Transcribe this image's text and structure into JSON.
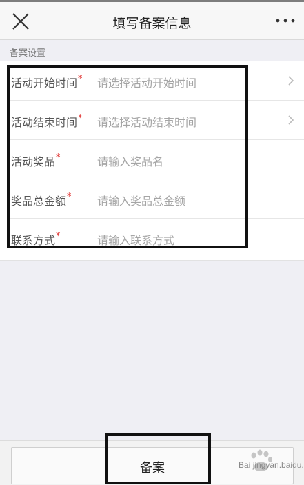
{
  "header": {
    "title": "填写备案信息",
    "close_icon": "close-icon",
    "more_icon": "more-icon"
  },
  "section": {
    "label": "备案设置"
  },
  "form": {
    "required_mark": "*",
    "rows": [
      {
        "label": "活动开始时间",
        "placeholder": "请选择活动开始时间",
        "has_chevron": true
      },
      {
        "label": "活动结束时间",
        "placeholder": "请选择活动结束时间",
        "has_chevron": true
      },
      {
        "label": "活动奖品",
        "placeholder": "请输入奖品名",
        "has_chevron": false
      },
      {
        "label": "奖品总金额",
        "placeholder": "请输入奖品总金额",
        "has_chevron": false
      },
      {
        "label": "联系方式",
        "placeholder": "请输入联系方式",
        "has_chevron": false
      }
    ]
  },
  "footer": {
    "submit_label": "备案"
  },
  "watermark": {
    "brand": "Bai",
    "text": "jingyan.baidu.com"
  },
  "colors": {
    "required": "#e0312f",
    "placeholder": "#a5a5a5",
    "annotation_border": "#111111"
  }
}
